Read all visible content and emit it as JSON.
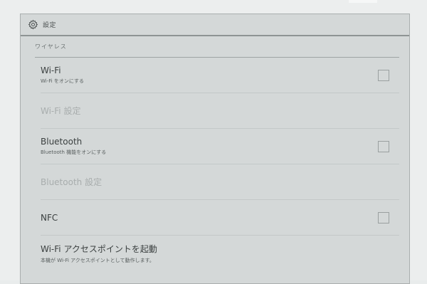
{
  "header": {
    "title": "設定",
    "icon": "gear-icon"
  },
  "section": {
    "title": "ワイヤレス"
  },
  "rows": [
    {
      "label": "Wi-Fi",
      "sub": "Wi-Fi をオンにする",
      "checked": false
    },
    {
      "label": "Wi-Fi 設定"
    },
    {
      "label": "Bluetooth",
      "sub": "Bluetooth 機能をオンにする",
      "checked": false
    },
    {
      "label": "Bluetooth 設定"
    },
    {
      "label": "NFC",
      "checked": false
    },
    {
      "label": "Wi-Fi アクセスポイントを起動",
      "sub": "本機が Wi-Fi アクセスポイントとして動作します。"
    }
  ]
}
